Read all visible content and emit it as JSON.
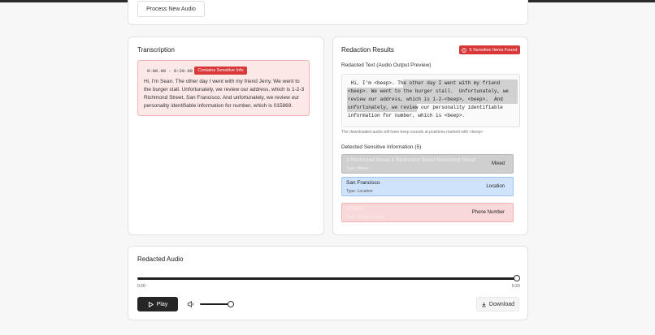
{
  "process": {
    "button_label": "Process New Audio"
  },
  "transcription": {
    "title": "Transcription",
    "timestamp": "0:00.00 - 0:20.00",
    "badge": "Contains Sensitive Info",
    "text": "Hi, I'm Sean. The other day I went with my friend Jerry. We went to the burger stall. Unfortunately, we review our address, which is 1-2-3 Richmond Street, San Francisco. And unfortunately, we review our personality identifiable information for number, which is 015869."
  },
  "redaction": {
    "title": "Redaction Results",
    "badge": "5 Sensitive Items Found",
    "redacted_title": "Redacted Text (Audio Output Preview)",
    "redacted_text": " Hi, I'm <beep>. The other day I went with my friend <beep>. We went to the burger stall.  Unfortunately, we review our address, which is 1-2-<beep>, <beep>.  And unfortunately, we review our personality identifiable information for number, which is <beep>.",
    "note": "The downloaded audio will have beep sounds at positions marked with <beep>",
    "detected_title": "Detected Sensitive Information (5)",
    "items": [
      {
        "name": "3 Richmond Street 3 Richmond Street Richmond Street",
        "type": "Type: Mixed",
        "tag": "Mixed"
      },
      {
        "name": "San Francisco",
        "type": "Type: Location",
        "tag": "Location"
      },
      {
        "name": "015869",
        "type": "Type: Phone Number",
        "tag": "Phone Number"
      }
    ]
  },
  "audio": {
    "title": "Redacted Audio",
    "time_start": "0:20",
    "time_end": "0:20",
    "progress": 1.0,
    "volume": 0.9,
    "play_label": "Play",
    "download_label": "Download"
  },
  "colors": {
    "danger": "#d93838",
    "dark": "#262626",
    "location_bg": "#cfe4fb",
    "phone_bg": "#f8d8d8",
    "mixed_bg": "#cfcfcf"
  }
}
